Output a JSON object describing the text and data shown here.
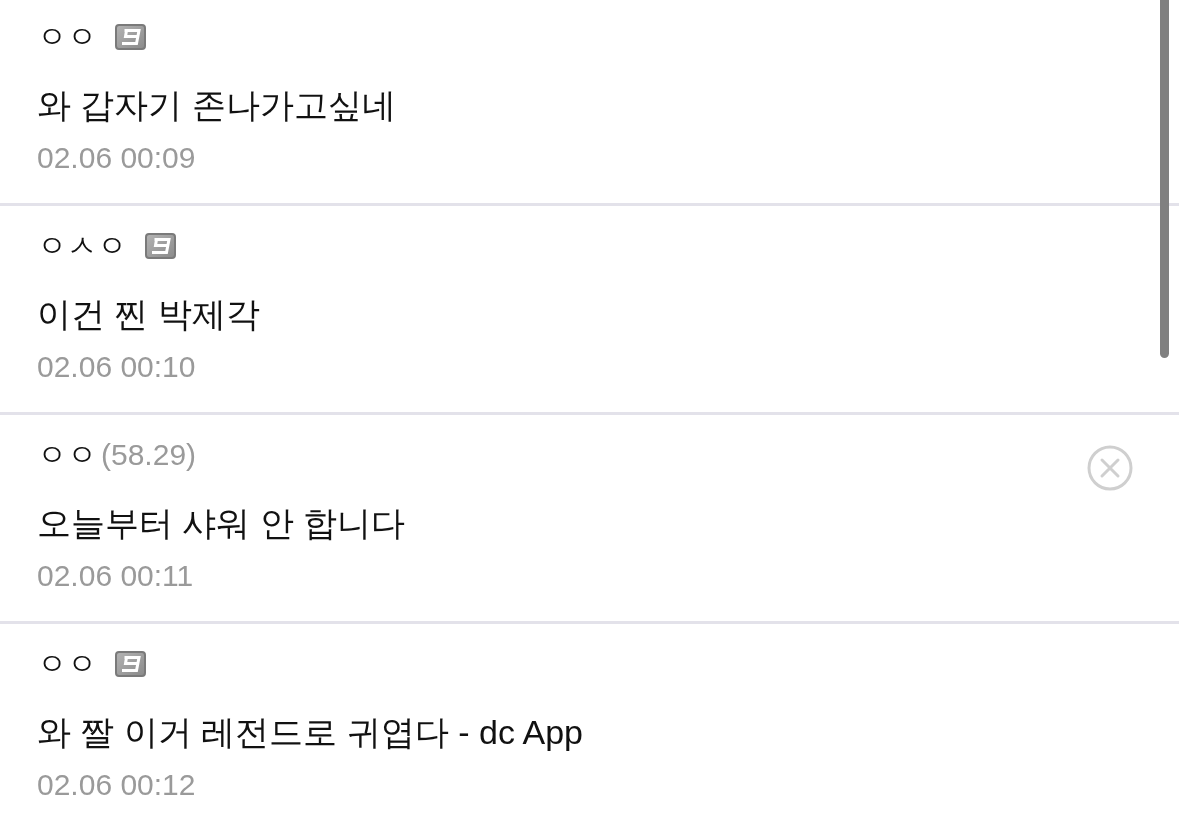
{
  "comments": [
    {
      "kind": "member",
      "nickname": "ㅇㅇ",
      "text": "와 갑자기 존나가고싶네",
      "date": "02.06 00:09",
      "deletable": false
    },
    {
      "kind": "member",
      "nickname": "ㅇㅅㅇ",
      "text": "이건 찐 박제각",
      "date": "02.06 00:10",
      "deletable": false
    },
    {
      "kind": "guest",
      "nickname": "ㅇㅇ",
      "ip": "(58.29)",
      "text": "오늘부터 샤워 안 합니다",
      "date": "02.06 00:11",
      "deletable": true
    },
    {
      "kind": "member",
      "nickname": "ㅇㅇ",
      "text": "와 짤 이거 레전드로 귀엽다 - dc App",
      "date": "02.06 00:12",
      "deletable": false
    }
  ]
}
